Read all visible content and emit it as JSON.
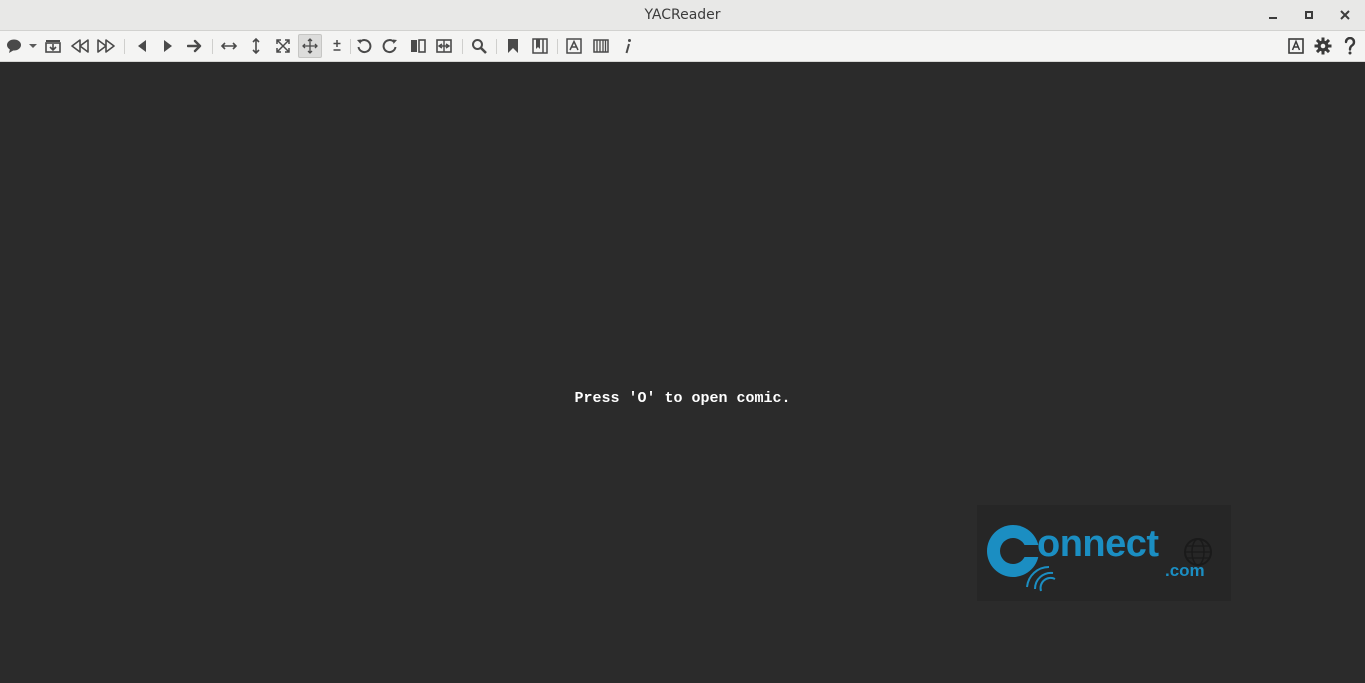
{
  "window": {
    "title": "YACReader"
  },
  "toolbar": {
    "left_icons": [
      "comment-icon",
      "dropdown-caret-icon",
      "open-folder-icon",
      "previous-comic-icon",
      "next-comic-icon",
      "previous-page-icon",
      "next-page-icon",
      "go-to-page-icon",
      "fit-width-icon",
      "fit-height-icon",
      "fit-to-page-icon",
      "original-size-icon",
      "zoom-level-icon",
      "rotate-left-icon",
      "rotate-right-icon",
      "double-page-icon",
      "double-page-manga-icon",
      "magnifying-glass-icon",
      "bookmark-icon",
      "show-bookmarks-icon",
      "translator-icon",
      "thumbnails-icon",
      "comic-info-icon"
    ],
    "right_icons": [
      "keyboard-shortcuts-icon",
      "settings-gear-icon",
      "help-question-icon"
    ],
    "active_icon": "original-size-icon"
  },
  "viewer": {
    "hint": "Press 'O' to open comic."
  },
  "watermark": {
    "word": "onnect",
    "tld": ".com",
    "color": "#1b8ec2"
  }
}
